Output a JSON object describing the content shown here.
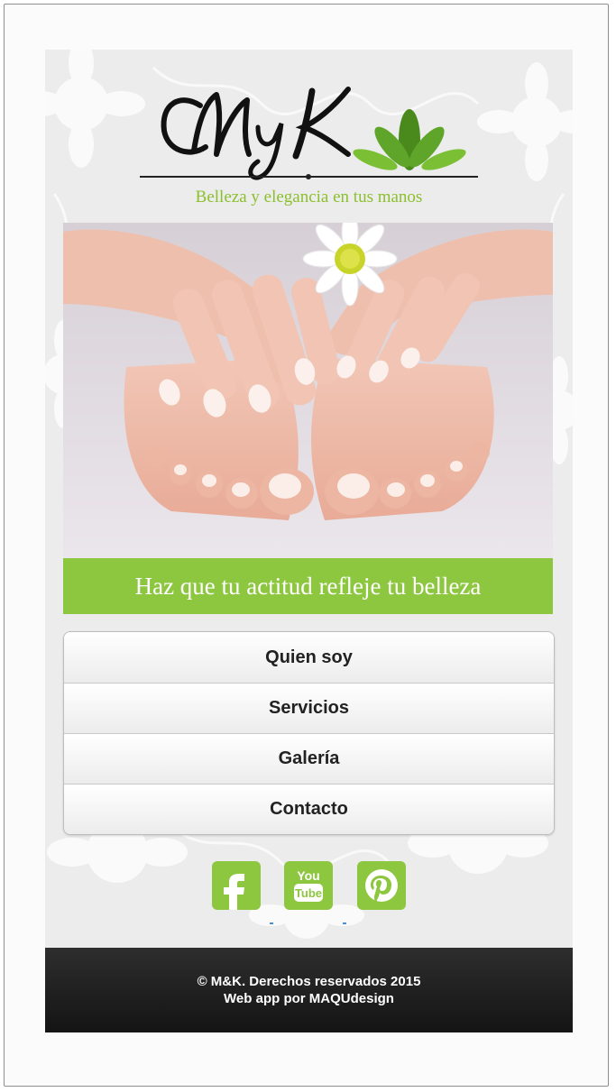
{
  "brand": {
    "logo_text": "MyK",
    "tagline": "Belleza y elegancia en tus manos"
  },
  "hero": {
    "slogan": "Haz que tu actitud refleje tu belleza"
  },
  "menu": {
    "items": [
      {
        "label": "Quien soy"
      },
      {
        "label": "Servicios"
      },
      {
        "label": "Galería"
      },
      {
        "label": "Contacto"
      }
    ]
  },
  "social": {
    "icons": [
      "facebook-icon",
      "youtube-icon",
      "pinterest-icon"
    ],
    "youtube_top": "You",
    "youtube_bottom": "Tube"
  },
  "footer": {
    "copyright": "© M&K. Derechos reservados 2015",
    "credit": "Web app por MAQUdesign"
  },
  "colors": {
    "accent": "#8dc63f",
    "footer_bg": "#1c1c1c",
    "page_bg": "#ececec"
  }
}
